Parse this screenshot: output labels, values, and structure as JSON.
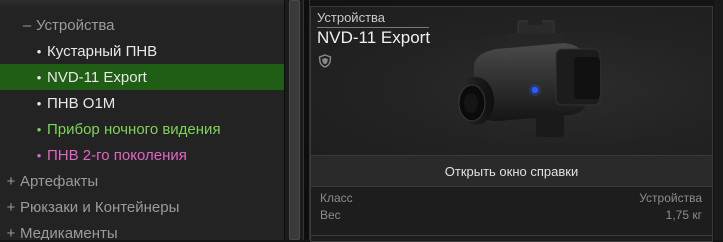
{
  "tree": {
    "rows": [
      {
        "sign": "–",
        "label": "Устройства"
      },
      {
        "label": "Кустарный ПНВ"
      },
      {
        "label": "NVD-11 Export"
      },
      {
        "label": "ПНВ О1М"
      },
      {
        "label": "Прибор ночного видения"
      },
      {
        "label": "ПНВ 2-го поколения"
      },
      {
        "sign": "+",
        "label": "Артефакты"
      },
      {
        "sign": "+",
        "label": "Рюкзаки и Контейнеры"
      },
      {
        "sign": "+",
        "label": "Медикаменты"
      }
    ],
    "bullet": "•"
  },
  "card": {
    "category": "Устройства",
    "title": "NVD-11 Export",
    "shield_icon": "shield-icon",
    "help_button_label": "Открыть окно справки",
    "properties": [
      {
        "name": "Класс",
        "value": "Устройства"
      },
      {
        "name": "Вес",
        "value": "1,75 кг"
      }
    ]
  },
  "colors": {
    "selected_row": "#1f5e14",
    "green_item": "#7ed35a",
    "pink_item": "#e066c4",
    "text": "#e8e8e8"
  }
}
